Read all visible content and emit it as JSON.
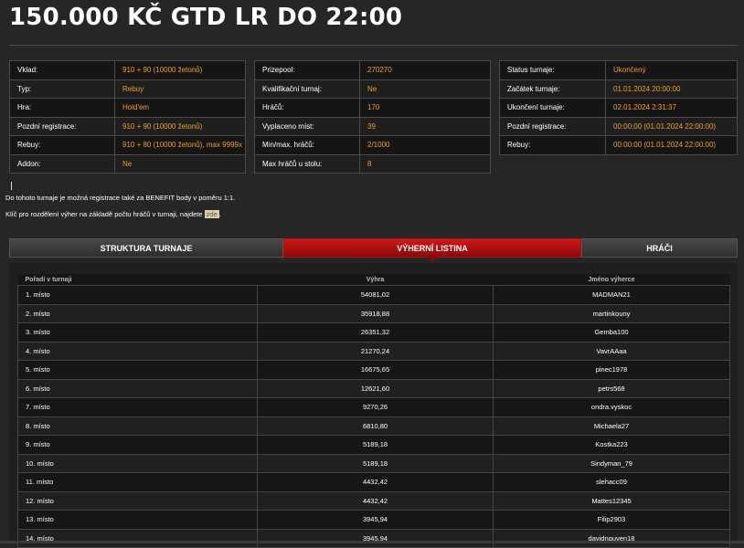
{
  "page": {
    "title": "150.000 KČ GTD LR DO 22:00"
  },
  "info_left": [
    {
      "key": "Vklad:",
      "value": "910 + 90 (10000 žetonů)"
    },
    {
      "key": "Typ:",
      "value": "Rebuy"
    },
    {
      "key": "Hra:",
      "value": "Hold'em"
    },
    {
      "key": "Pozdní registrace:",
      "value": "910 + 90 (10000 žetonů)"
    },
    {
      "key": "Rebuy:",
      "value": "910 + 80 (10000 žetonů), max 9999x"
    },
    {
      "key": "Addon:",
      "value": "Ne"
    }
  ],
  "info_mid": [
    {
      "key": "Prizepool:",
      "value": "270270"
    },
    {
      "key": "Kvalifikační turnaj:",
      "value": "Ne"
    },
    {
      "key": "Hráčů:",
      "value": "170"
    },
    {
      "key": "Vyplaceno míst:",
      "value": "39"
    },
    {
      "key": "Min/max. hráčů:",
      "value": "2/1000"
    },
    {
      "key": "Max hráčů u stolu:",
      "value": "8"
    }
  ],
  "info_right": [
    {
      "key": "Status turnaje:",
      "value": "Ukončený"
    },
    {
      "key": "Začátek turnaje:",
      "value": "01.01.2024 20:00:00"
    },
    {
      "key": "Ukončení turnaje:",
      "value": "02.01.2024 2:31:37"
    },
    {
      "key": "Pozdní registrace:",
      "value": "00:00:00 (01.01.2024 22:00:00)"
    },
    {
      "key": "Rebuy:",
      "value": "00:00:00 (01.01.2024 22:00:00)"
    }
  ],
  "notes": {
    "benefit": "Do tohoto turnaje je možná registrace také za BENEFIT body v poměru 1:1.",
    "key_text": "Klíč pro rozdělení výher na základě počtu hráčů v turnaji, najdete ",
    "key_link": "zde",
    "key_end": "."
  },
  "tabs": {
    "structure": "STRUKTURA TURNAJE",
    "winners": "VÝHERNÍ LISTINA",
    "players": "HRÁČI"
  },
  "results": {
    "headers": [
      "Pořadí v turnaji",
      "Výhra",
      "Jméno výherce"
    ],
    "rows": [
      {
        "place": "1. místo",
        "prize": "54081,02",
        "name": "MADMAN21"
      },
      {
        "place": "2. místo",
        "prize": "35918,88",
        "name": "martinkouny"
      },
      {
        "place": "3. místo",
        "prize": "26351,32",
        "name": "Gemba100"
      },
      {
        "place": "4. místo",
        "prize": "21270,24",
        "name": "VavrAAaa"
      },
      {
        "place": "5. místo",
        "prize": "16675,65",
        "name": "pinec1978"
      },
      {
        "place": "6. místo",
        "prize": "12621,60",
        "name": "petrs568"
      },
      {
        "place": "7. místo",
        "prize": "9270,26",
        "name": "ondra.vyskoc"
      },
      {
        "place": "8. místo",
        "prize": "6810,80",
        "name": "Michaela27"
      },
      {
        "place": "9. místo",
        "prize": "5189,18",
        "name": "Kostka223"
      },
      {
        "place": "10. místo",
        "prize": "5189,18",
        "name": "Sindyman_79"
      },
      {
        "place": "11. místo",
        "prize": "4432,42",
        "name": "slehacc09"
      },
      {
        "place": "12. místo",
        "prize": "4432,42",
        "name": "Mattes12345"
      },
      {
        "place": "13. místo",
        "prize": "3945,94",
        "name": "Filip2903"
      },
      {
        "place": "14. místo",
        "prize": "3945,94",
        "name": "davidnguyen18"
      }
    ]
  }
}
